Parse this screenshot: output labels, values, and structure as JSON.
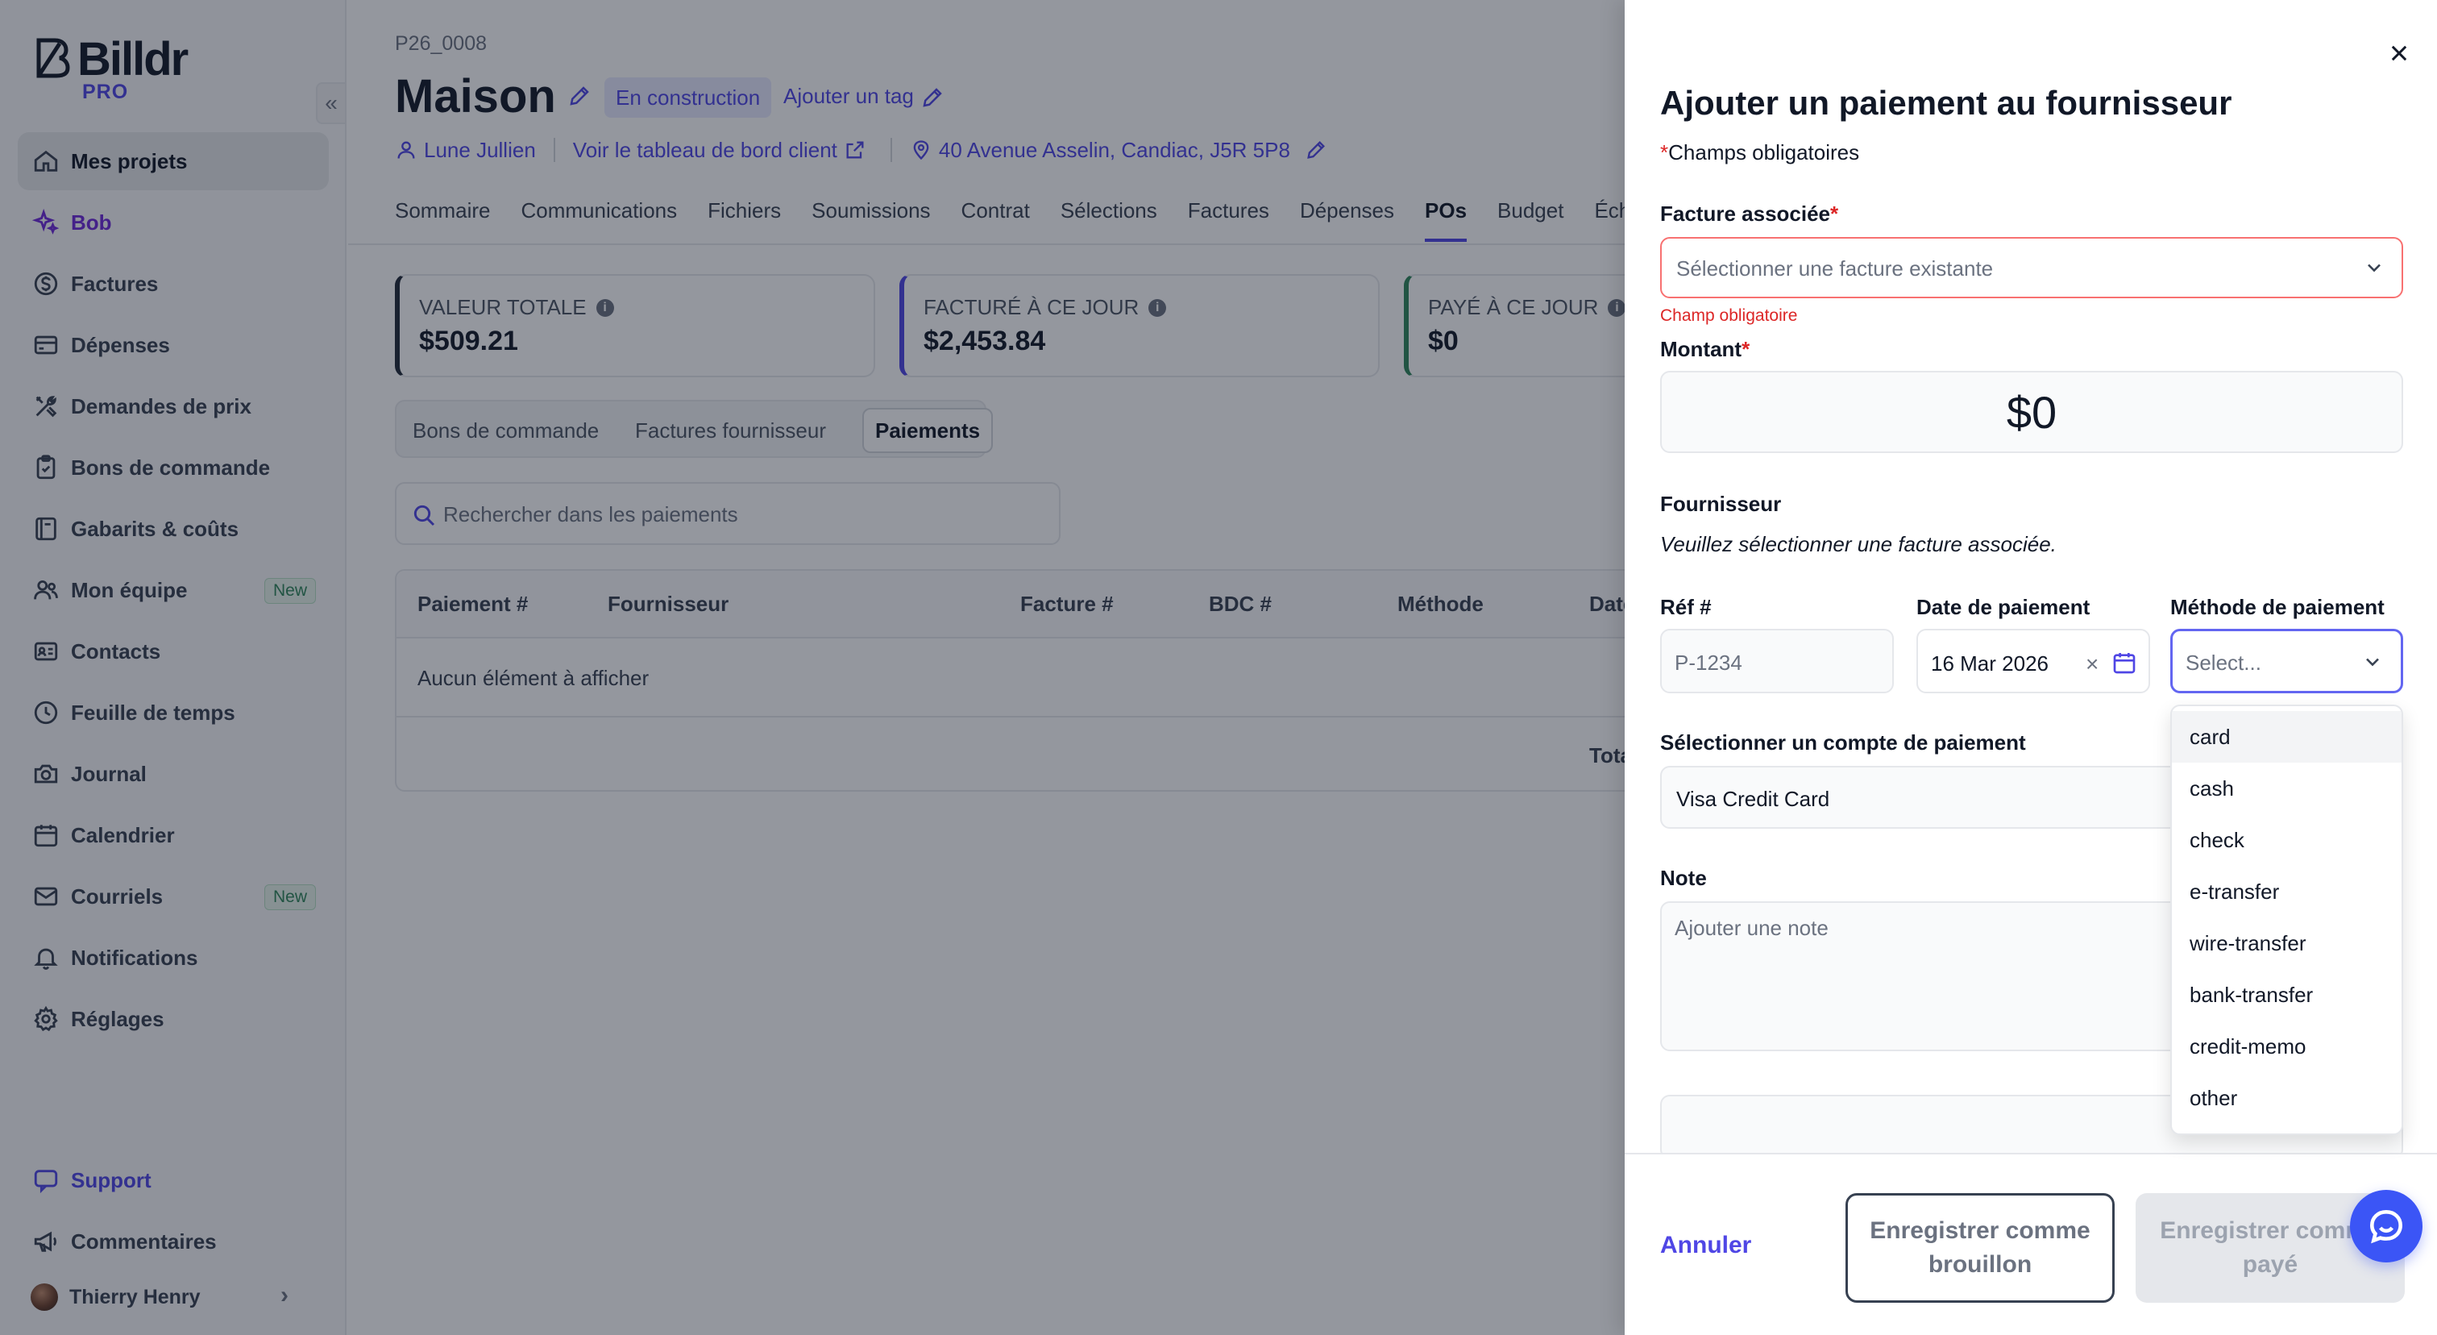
{
  "brand": {
    "name": "Billdr",
    "tier": "PRO"
  },
  "sidebar": {
    "items": [
      {
        "label": "Mes projets"
      },
      {
        "label": "Bob"
      },
      {
        "label": "Factures"
      },
      {
        "label": "Dépenses"
      },
      {
        "label": "Demandes de prix"
      },
      {
        "label": "Bons de commande"
      },
      {
        "label": "Gabarits & coûts"
      },
      {
        "label": "Mon équipe",
        "badge": "New"
      },
      {
        "label": "Contacts"
      },
      {
        "label": "Feuille de temps"
      },
      {
        "label": "Journal"
      },
      {
        "label": "Calendrier"
      },
      {
        "label": "Courriels",
        "badge": "New"
      },
      {
        "label": "Notifications"
      },
      {
        "label": "Réglages"
      }
    ],
    "bottom": [
      {
        "label": "Support"
      },
      {
        "label": "Commentaires"
      }
    ],
    "user": {
      "name": "Thierry Henry"
    }
  },
  "project": {
    "code": "P26_0008",
    "title": "Maison",
    "status": "En construction",
    "add_tag": "Ajouter un tag",
    "client": "Lune Jullien",
    "dashboard_link": "Voir le tableau de bord client",
    "address": "40 Avenue Asselin, Candiac, J5R 5P8"
  },
  "tabs": [
    "Sommaire",
    "Communications",
    "Fichiers",
    "Soumissions",
    "Contrat",
    "Sélections",
    "Factures",
    "Dépenses",
    "POs",
    "Budget",
    "Échéancier"
  ],
  "kpis": [
    {
      "label": "VALEUR TOTALE",
      "value": "$509.21",
      "color": "#1f2937"
    },
    {
      "label": "FACTURÉ À CE JOUR",
      "value": "$2,453.84",
      "color": "#4f46e5"
    },
    {
      "label": "PAYÉ À CE JOUR",
      "value": "$0",
      "color": "#2f855a"
    }
  ],
  "subtabs": [
    "Bons de commande",
    "Factures fournisseur",
    "Paiements"
  ],
  "search": {
    "placeholder": "Rechercher dans les paiements"
  },
  "table": {
    "headers": [
      "Paiement #",
      "Fournisseur",
      "Facture #",
      "BDC #",
      "Méthode",
      "Date"
    ],
    "empty": "Aucun élément à afficher",
    "total_label": "Total"
  },
  "drawer": {
    "title": "Ajouter un paiement au fournisseur",
    "required_note": "Champs obligatoires",
    "invoice_label": "Facture associée",
    "invoice_placeholder": "Sélectionner une facture existante",
    "invoice_error": "Champ obligatoire",
    "amount_label": "Montant",
    "amount_value": "$0",
    "supplier_label": "Fournisseur",
    "supplier_hint": "Veuillez sélectionner une facture associée.",
    "ref_label": "Réf #",
    "ref_placeholder": "P-1234",
    "date_label": "Date de paiement",
    "date_value": "16 Mar 2026",
    "method_label": "Méthode de paiement",
    "method_placeholder": "Select...",
    "method_options": [
      "card",
      "cash",
      "check",
      "e-transfer",
      "wire-transfer",
      "bank-transfer",
      "credit-memo",
      "other"
    ],
    "account_label": "Sélectionner un compte de paiement",
    "account_value": "Visa Credit Card",
    "note_label": "Note",
    "note_placeholder": "Ajouter une note",
    "cancel_label": "Annuler",
    "draft_label": "Enregistrer comme brouillon",
    "paid_label": "Enregistrer comme payé"
  },
  "colors": {
    "accent": "#4f46e5",
    "error": "#dc2626",
    "bob": "#6d28d9",
    "fab": "#3b55f6"
  }
}
